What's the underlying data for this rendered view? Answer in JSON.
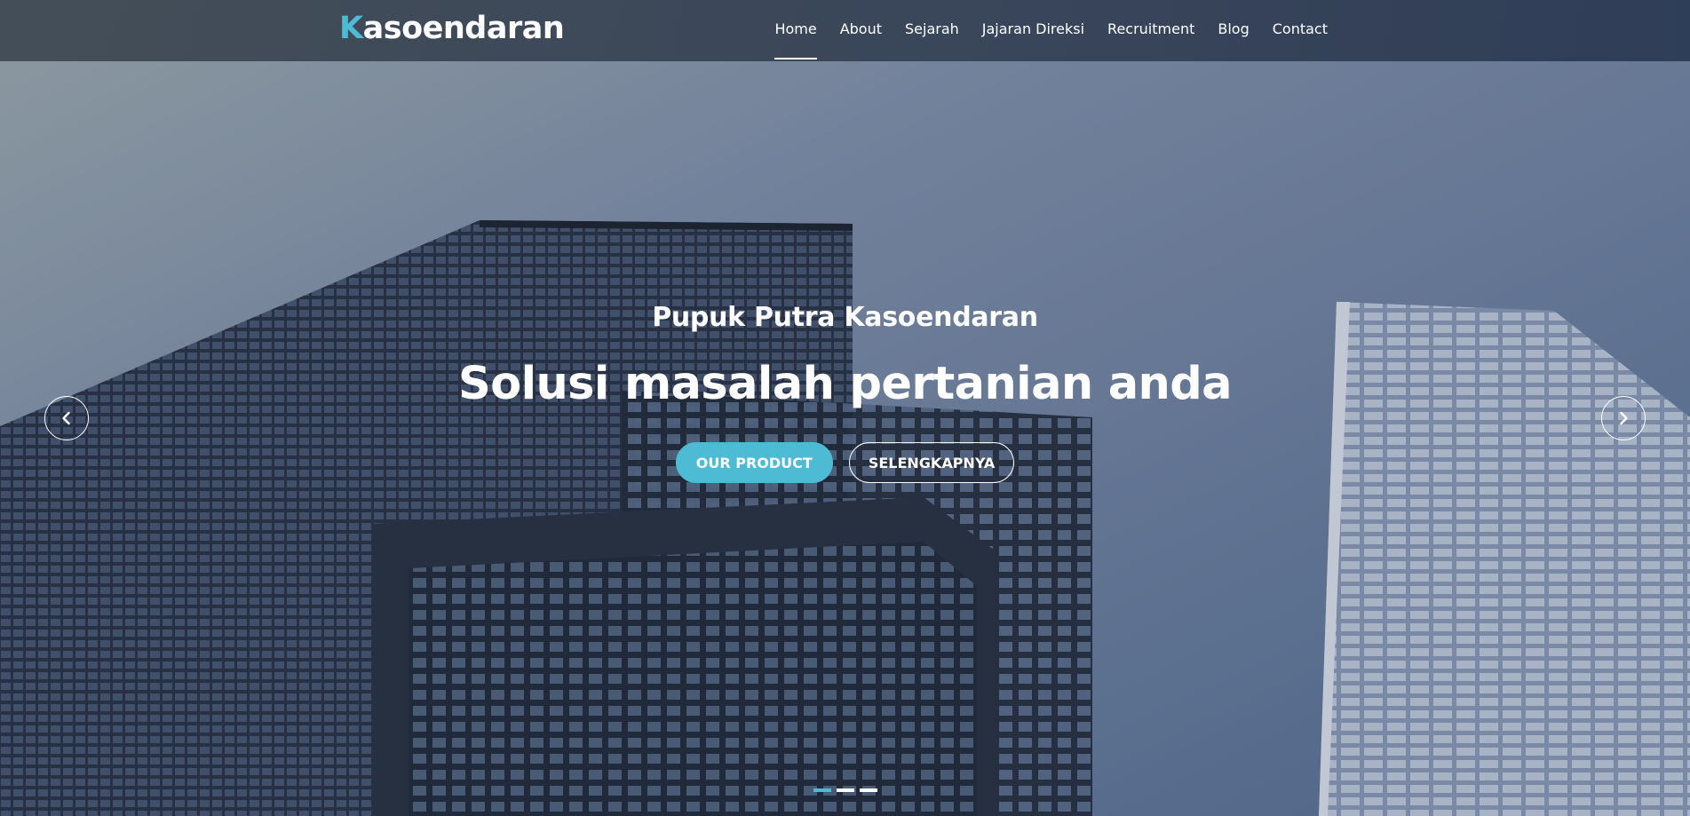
{
  "brand": {
    "first_letter": "K",
    "rest": "asoendaran"
  },
  "nav": {
    "items": [
      {
        "label": "Home",
        "active": true
      },
      {
        "label": "About"
      },
      {
        "label": "Sejarah"
      },
      {
        "label": "Jajaran Direksi"
      },
      {
        "label": "Recruitment"
      },
      {
        "label": "Blog"
      },
      {
        "label": "Contact"
      }
    ]
  },
  "hero": {
    "subtitle": "Pupuk Putra Kasoendaran",
    "title": "Solusi masalah pertanian anda",
    "primary_button": "OUR PRODUCT",
    "secondary_button": "SELENGKAPNYA",
    "prev_icon": "chevron-left-icon",
    "next_icon": "chevron-right-icon",
    "slide_count": 3,
    "active_slide": 1
  },
  "colors": {
    "accent": "#4ebbd4",
    "text": "#ffffff"
  }
}
